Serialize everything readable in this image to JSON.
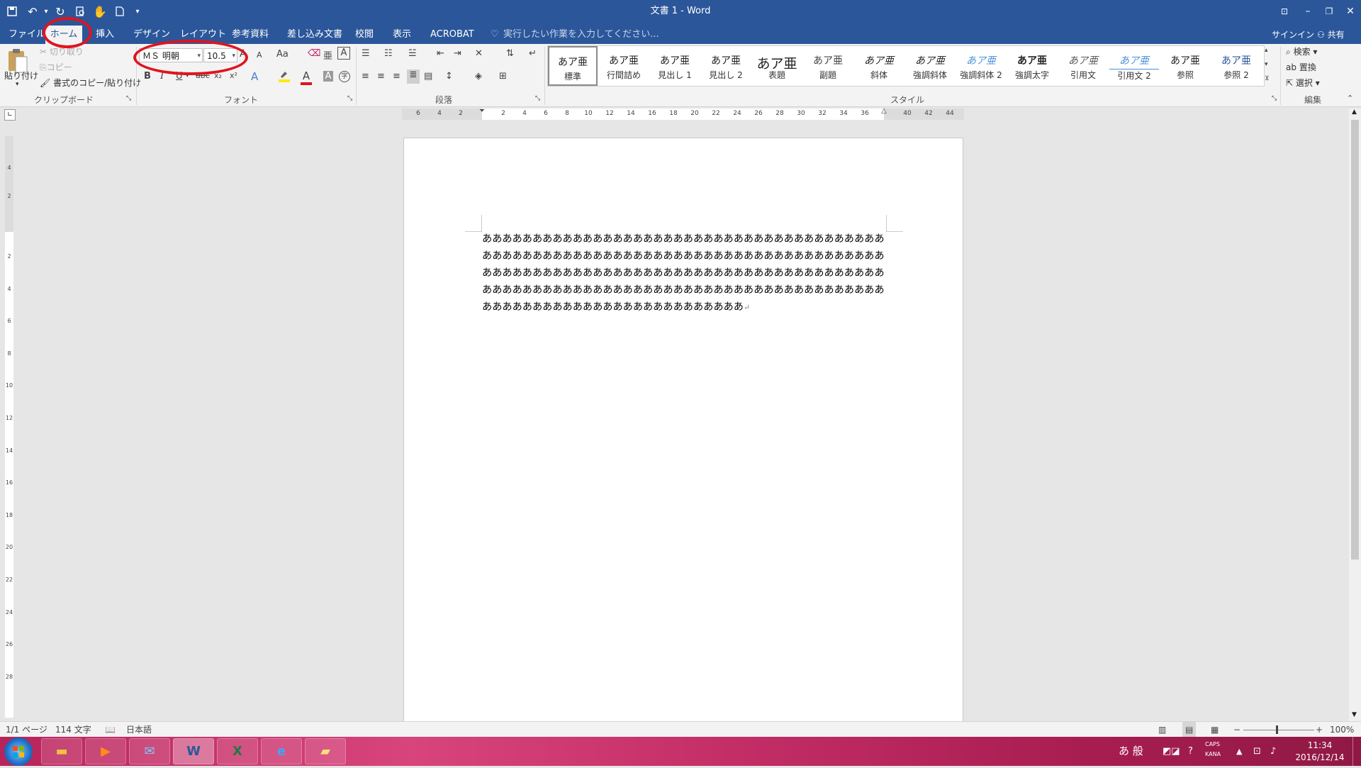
{
  "window": {
    "title": "文書 1 - Word",
    "controls": {
      "ribbon_display": "⊡",
      "minimize": "–",
      "restore": "❐",
      "close": "✕"
    }
  },
  "quick_access": {
    "customize": "▾"
  },
  "tabs": [
    {
      "label": "ファイル",
      "active": false
    },
    {
      "label": "ホーム",
      "active": true
    },
    {
      "label": "挿入",
      "active": false
    },
    {
      "label": "デザイン",
      "active": false
    },
    {
      "label": "レイアウト",
      "active": false
    },
    {
      "label": "参考資料",
      "active": false
    },
    {
      "label": "差し込み文書",
      "active": false
    },
    {
      "label": "校閲",
      "active": false
    },
    {
      "label": "表示",
      "active": false
    },
    {
      "label": "ACROBAT",
      "active": false
    }
  ],
  "tell_me": {
    "placeholder": "実行したい作業を入力してください..."
  },
  "account": {
    "signin": "サインイン",
    "share": "共有"
  },
  "clipboard": {
    "label": "クリップボード",
    "paste": "貼り付け",
    "cut": "切り取り",
    "copy": "コピー",
    "format_painter": "書式のコピー/貼り付け"
  },
  "font": {
    "label": "フォント",
    "name": "ＭＳ 明朝",
    "size": "10.5",
    "grow": "A",
    "shrink": "A",
    "change_case": "Aa",
    "bold": "B",
    "italic": "I",
    "underline": "U",
    "strike": "abc",
    "subscript": "x₂",
    "superscript": "x²",
    "text_effects": "A",
    "font_color": "A",
    "char_shading": "A",
    "enclose": "字"
  },
  "paragraph": {
    "label": "段落"
  },
  "styles": {
    "label": "スタイル",
    "items": [
      {
        "preview": "あア亜",
        "name": "標準"
      },
      {
        "preview": "あア亜",
        "name": "行間詰め"
      },
      {
        "preview": "あア亜",
        "name": "見出し 1"
      },
      {
        "preview": "あア亜",
        "name": "見出し 2"
      },
      {
        "preview": "あア亜",
        "name": "表題"
      },
      {
        "preview": "あア亜",
        "name": "副題"
      },
      {
        "preview": "あア亜",
        "name": "斜体"
      },
      {
        "preview": "あア亜",
        "name": "強調斜体"
      },
      {
        "preview": "あア亜",
        "name": "強調斜体 2"
      },
      {
        "preview": "あア亜",
        "name": "強調太字"
      },
      {
        "preview": "あア亜",
        "name": "引用文"
      },
      {
        "preview": "あア亜",
        "name": "引用文 2"
      },
      {
        "preview": "あア亜",
        "name": "参照"
      },
      {
        "preview": "あア亜",
        "name": "参照 2"
      }
    ]
  },
  "editing": {
    "label": "編集",
    "find": "検索",
    "replace": "置換",
    "select": "選択"
  },
  "ruler": {
    "h_left_ticks": [
      "6",
      "4",
      "2"
    ],
    "h_ticks": [
      "2",
      "4",
      "6",
      "8",
      "10",
      "12",
      "14",
      "16",
      "18",
      "20",
      "22",
      "24",
      "26",
      "28",
      "30",
      "32",
      "34",
      "36"
    ],
    "h_right_ticks": [
      "40",
      "42",
      "44"
    ],
    "v_top_ticks": [
      "4",
      "2"
    ],
    "v_ticks": [
      "2",
      "4",
      "6",
      "8",
      "10",
      "12",
      "14",
      "16",
      "18",
      "20",
      "22",
      "24",
      "26",
      "28"
    ]
  },
  "document": {
    "text": "ああああああああああああああああああああああああああああああああああああああああああああああああああああああああああああああああああああああああああああああああああああああああああああああああああああああああああああああああああああああああああああああああああああああああああああああああああああああああああああああああああああああああああああああああああああああああああ",
    "paragraph_mark": "↵"
  },
  "status": {
    "page": "1/1 ページ",
    "words": "114 文字",
    "language": "日本語",
    "zoom": "100%"
  },
  "taskbar": {
    "clock_time": "11:34",
    "clock_date": "2016/12/14",
    "ime": "あ 般",
    "caps": "CAPS",
    "kana": "KANA"
  },
  "colors": {
    "title_bg": "#2b579a",
    "ribbon_bg": "#f3f3f3",
    "highlight_red": "#e0141e",
    "taskbar": "#c22d66"
  }
}
